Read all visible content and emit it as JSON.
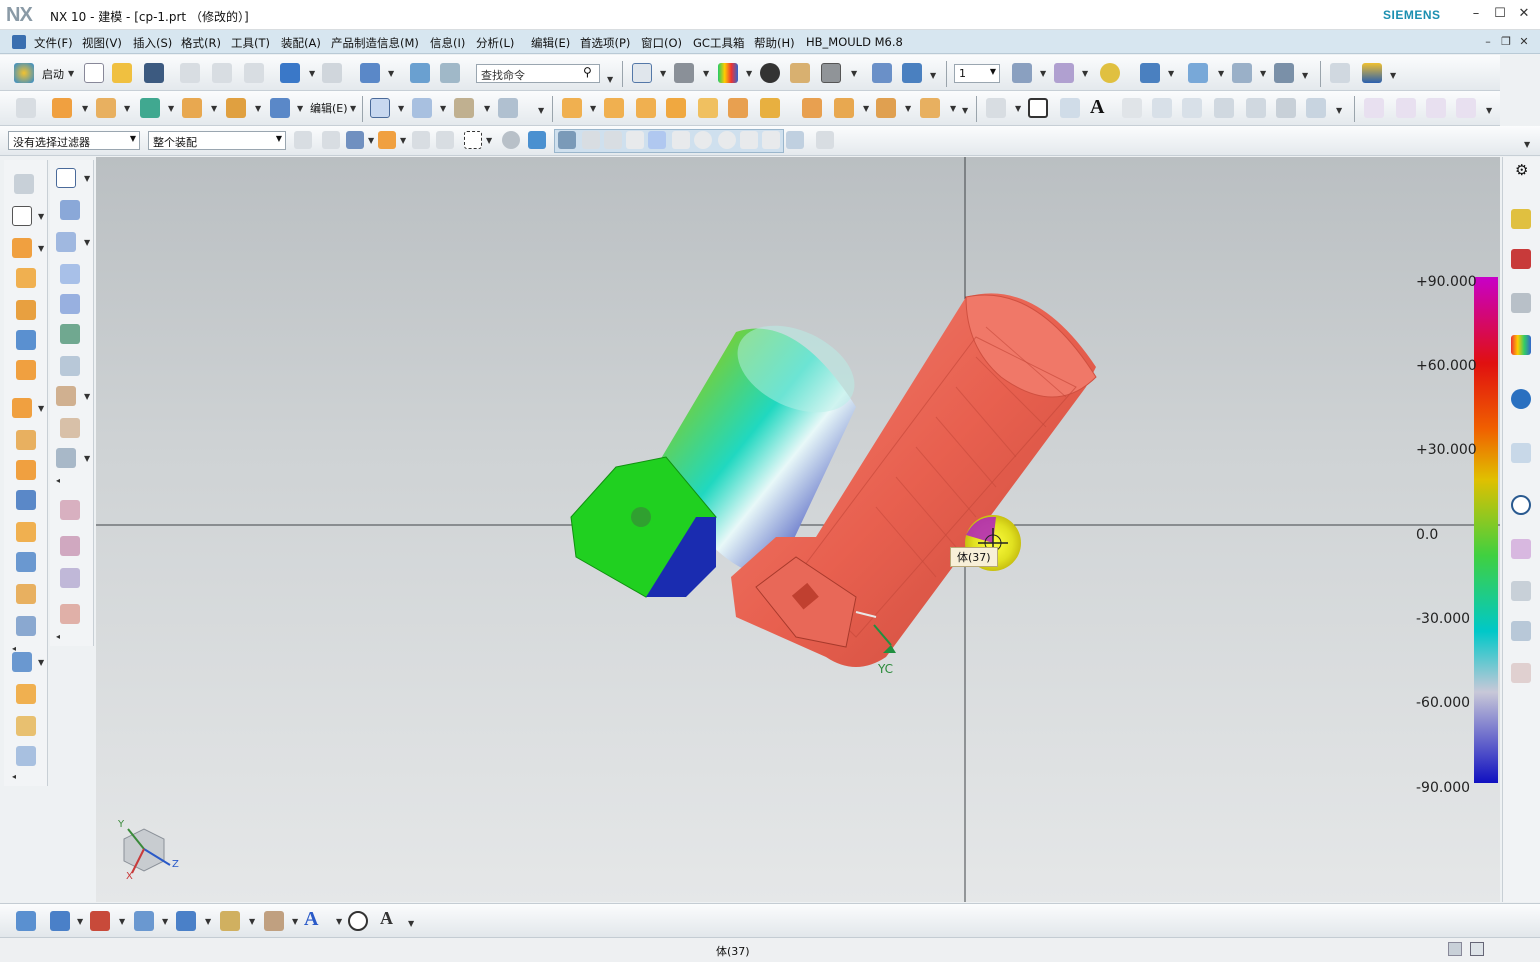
{
  "app": {
    "logo": "NX",
    "title": "NX 10 - 建模 - [cp-1.prt （修改的）]",
    "brand": "SIEMENS"
  },
  "menu": [
    "文件(F)",
    "视图(V)",
    "插入(S)",
    "格式(R)",
    "工具(T)",
    "装配(A)",
    "产品制造信息(M)",
    "信息(I)",
    "分析(L)",
    "编辑(E)",
    "首选项(P)",
    "窗口(O)",
    "GC工具箱",
    "帮助(H)",
    "HB_MOULD M6.8"
  ],
  "toolbar1": {
    "start_label": "启动",
    "search_placeholder": "查找命令",
    "layer_value": "1"
  },
  "toolbar2": {
    "edit_label": "编辑(E)"
  },
  "filterbar": {
    "selection_filter": "没有选择过滤器",
    "scope": "整个装配"
  },
  "viewport": {
    "tooltip": "体(37)",
    "wcs_label": "YC",
    "triad": {
      "x": "X",
      "y": "Y",
      "z": "Z"
    },
    "scale": {
      "labels": [
        "+90.000",
        "+60.000",
        "+30.000",
        "0.0",
        "-30.000",
        "-60.000",
        "-90.000"
      ],
      "max": 90,
      "min": -90,
      "colors": [
        "#c800c8",
        "#e01010",
        "#f06000",
        "#e0c000",
        "#40d040",
        "#00c8c8",
        "#c8c8d8",
        "#1010c0"
      ]
    }
  },
  "status": {
    "text": "体(37)"
  },
  "colors": {
    "menubar": "#d7e6f0",
    "part_red": "#e8604f",
    "brand": "#1b8fb0"
  }
}
